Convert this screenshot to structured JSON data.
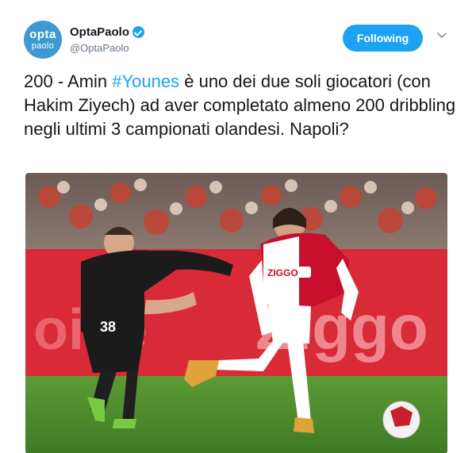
{
  "header": {
    "avatar_line1": "opta",
    "avatar_line2": "paolo",
    "display_name": "OptaPaolo",
    "handle": "@OptaPaolo",
    "verified_icon": "verified-badge-icon",
    "follow_label": "Following",
    "menu_icon": "chevron-down-icon"
  },
  "tweet": {
    "text_prefix": "200 - Amin ",
    "hashtag": "#Younes",
    "text_suffix": " è uno dei due soli giocatori (con Hakim Ziyech) ad aver completato almeno 200 dribbling negli ultimi 3 campionati olandesi. Napoli?"
  },
  "media": {
    "board_text": "Ziggo",
    "kit_sponsor": "ZIGGO",
    "number": "38"
  },
  "colors": {
    "accent": "#1da1f2",
    "avatar_bg": "#3d9ad1",
    "board_red": "#d92a37",
    "pitch_green": "#4e8a2e"
  }
}
